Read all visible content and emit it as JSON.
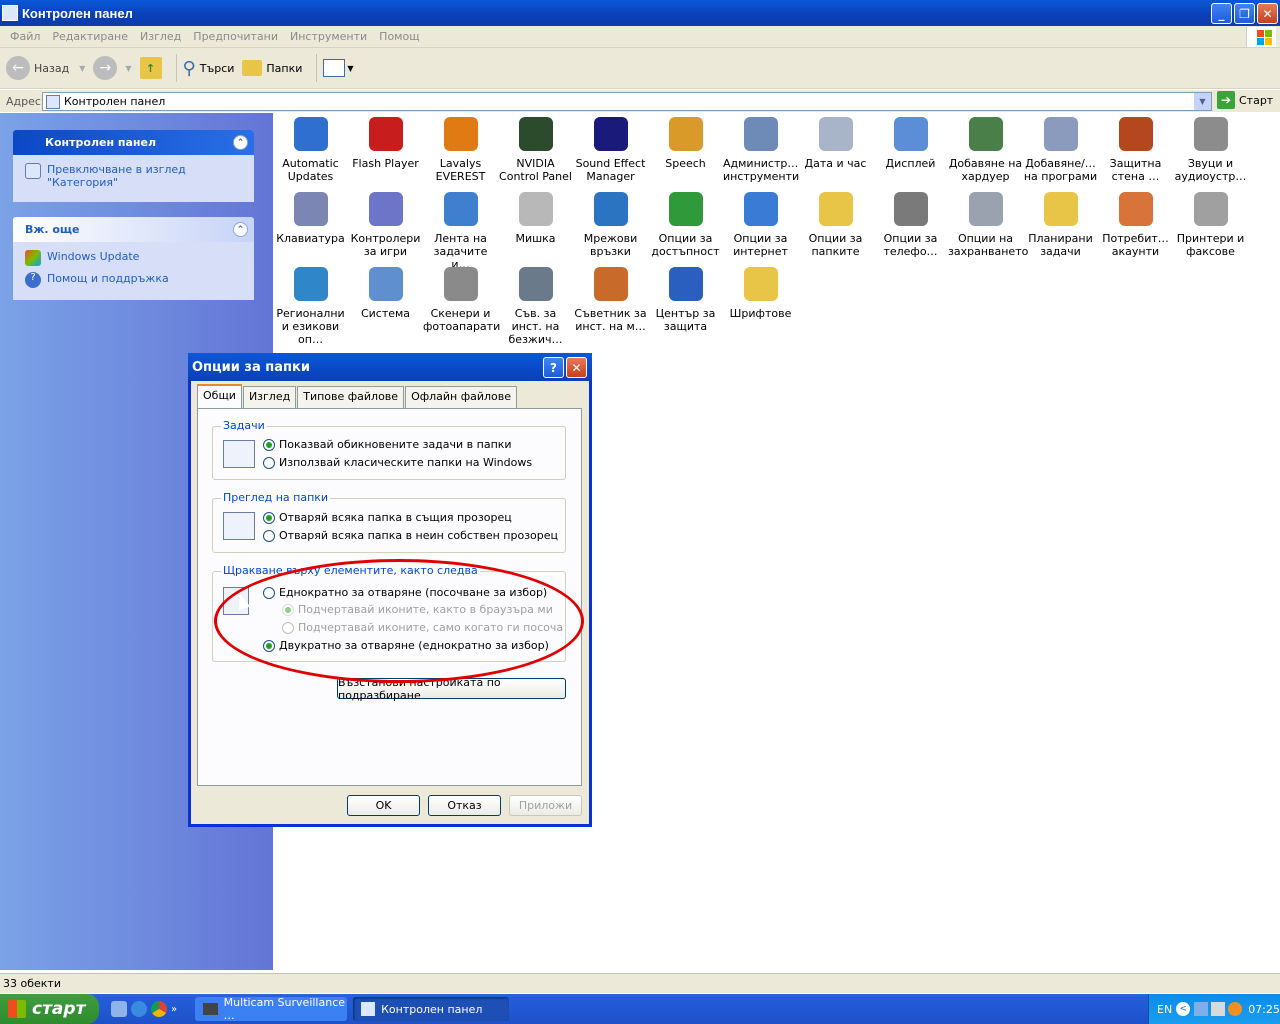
{
  "window": {
    "title": "Контролен панел"
  },
  "menu": [
    "Файл",
    "Редактиране",
    "Изглед",
    "Предпочитани",
    "Инструменти",
    "Помощ"
  ],
  "toolbar": {
    "back": "Назад",
    "search": "Търси",
    "folders": "Папки"
  },
  "address": {
    "label": "Адрес",
    "value": "Контролен панел",
    "go": "Старт"
  },
  "sidebar": {
    "panel1": {
      "title": "Контролен панел",
      "link": "Превключване в изглед \"Категория\""
    },
    "panel2": {
      "title": "Вж. още",
      "links": [
        "Windows Update",
        "Помощ и поддръжка"
      ]
    }
  },
  "icons": [
    {
      "label": "Automatic Updates",
      "icon": "automatic-updates-icon",
      "color": "#2f6fd0"
    },
    {
      "label": "Flash Player",
      "icon": "flash-player-icon",
      "color": "#c81d1d"
    },
    {
      "label": "Lavalys EVEREST",
      "icon": "everest-info-icon",
      "color": "#e07a12"
    },
    {
      "label": "NVIDIA Control Panel",
      "icon": "nvidia-icon",
      "color": "#2c4a2c"
    },
    {
      "label": "Sound Effect Manager",
      "icon": "sound-effect-icon",
      "color": "#1a1a7a"
    },
    {
      "label": "Speech",
      "icon": "speech-icon",
      "color": "#d99a2a"
    },
    {
      "label": "Администр… инструменти",
      "icon": "admin-tools-icon",
      "color": "#6e8bb8"
    },
    {
      "label": "Дата и час",
      "icon": "date-time-icon",
      "color": "#a8b4c8"
    },
    {
      "label": "Дисплей",
      "icon": "display-icon",
      "color": "#5b8ed6"
    },
    {
      "label": "Добавяне на хардуер",
      "icon": "add-hardware-icon",
      "color": "#4a7f4a"
    },
    {
      "label": "Добавяне/… на програми",
      "icon": "add-programs-icon",
      "color": "#8a9bbd"
    },
    {
      "label": "Защитна стена …",
      "icon": "firewall-icon",
      "color": "#b5471f"
    },
    {
      "label": "Звуци и аудиоустр…",
      "icon": "sounds-icon",
      "color": "#8c8c8c"
    },
    {
      "label": "Клавиатура",
      "icon": "keyboard-icon",
      "color": "#7b86b2"
    },
    {
      "label": "Контролери за игри",
      "icon": "game-controllers-icon",
      "color": "#6c75c8"
    },
    {
      "label": "Лента на задачите и…",
      "icon": "taskbar-icon",
      "color": "#3f7fd0"
    },
    {
      "label": "Мишка",
      "icon": "mouse-icon",
      "color": "#b8b8b8"
    },
    {
      "label": "Мрежови връзки",
      "icon": "network-icon",
      "color": "#2a74c2"
    },
    {
      "label": "Опции за достъпност",
      "icon": "accessibility-icon",
      "color": "#2f9a3a"
    },
    {
      "label": "Опции за интернет",
      "icon": "internet-options-icon",
      "color": "#3a7bd5"
    },
    {
      "label": "Опции за папките",
      "icon": "folder-options-icon",
      "color": "#e8c547"
    },
    {
      "label": "Опции за телефо…",
      "icon": "phone-modem-icon",
      "color": "#7a7a7a"
    },
    {
      "label": "Опции на захранването",
      "icon": "power-options-icon",
      "color": "#9aa2b0"
    },
    {
      "label": "Планирани задачи",
      "icon": "scheduled-tasks-icon",
      "color": "#e8c547"
    },
    {
      "label": "Потребит… акаунти",
      "icon": "user-accounts-icon",
      "color": "#d8743a"
    },
    {
      "label": "Принтери и факсове",
      "icon": "printers-icon",
      "color": "#a0a0a0"
    },
    {
      "label": "Регионални и езикови оп…",
      "icon": "regional-icon",
      "color": "#2f86c8"
    },
    {
      "label": "Система",
      "icon": "system-icon",
      "color": "#5f8fcf"
    },
    {
      "label": "Скенери и фотоапарати",
      "icon": "scanners-icon",
      "color": "#8a8a8a"
    },
    {
      "label": "Съв. за инст. на безжич…",
      "icon": "wireless-icon",
      "color": "#6a7a8a"
    },
    {
      "label": "Съветник за инст. на м…",
      "icon": "network-setup-icon",
      "color": "#c86a2a"
    },
    {
      "label": "Център за защита",
      "icon": "security-center-icon",
      "color": "#2b5fbf"
    },
    {
      "label": "Шрифтове",
      "icon": "fonts-icon",
      "color": "#e8c547"
    }
  ],
  "status": "33 обекти",
  "dialog": {
    "title": "Опции за папки",
    "tabs": [
      "Общи",
      "Изглед",
      "Типове файлове",
      "Офлайн файлове"
    ],
    "group1": {
      "title": "Задачи",
      "opt1": "Показвай обикновените задачи в папки",
      "opt2": "Използвай класическите папки на Windows"
    },
    "group2": {
      "title": "Преглед на папки",
      "opt1": "Отваряй всяка папка в същия прозорец",
      "opt2": "Отваряй всяка папка в неин собствен прозорец"
    },
    "group3": {
      "title": "Щракване върху елементите, както следва",
      "opt1": "Еднократно за  отваряне (посочване за избор)",
      "sub1": "Подчертавай  иконите,  както в  браузъра ми",
      "sub2": "Подчертавай  иконите, само когато ги посоча",
      "opt2": "Двукратно за  отваряне  (еднократно за избор)"
    },
    "restore": "Възстанови настройката по подразбиране",
    "ok": "OK",
    "cancel": "Отказ",
    "apply": "Приложи"
  },
  "taskbar": {
    "start": "старт",
    "tasks": [
      "Multicam Surveillance …",
      "Контролен панел"
    ],
    "lang": "EN",
    "time": "07:25"
  }
}
